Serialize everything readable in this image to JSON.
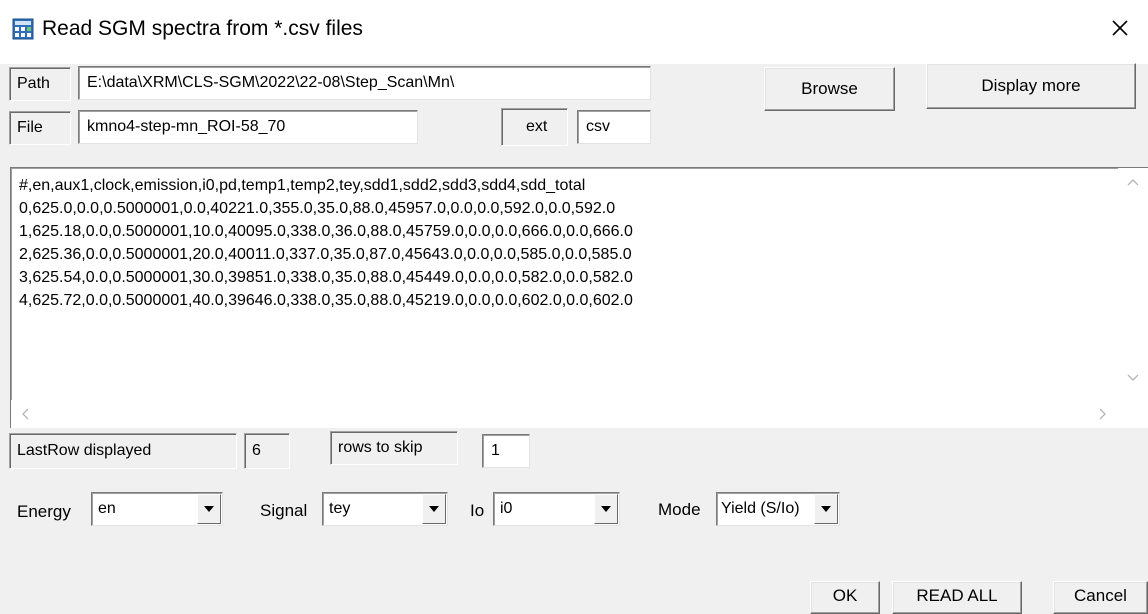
{
  "window": {
    "title": "Read SGM spectra from *.csv files",
    "app_icon": "calculator-table-icon",
    "close_glyph": "✕"
  },
  "path": {
    "label": "Path",
    "value": "E:\\data\\XRM\\CLS-SGM\\2022\\22-08\\Step_Scan\\Mn\\"
  },
  "file": {
    "label": "File",
    "value": "kmno4-step-mn_ROI-58_70"
  },
  "ext": {
    "label": "ext",
    "value": "csv"
  },
  "buttons": {
    "browse": "Browse",
    "display_more": "Display more",
    "ok": "OK",
    "read_all": "READ ALL",
    "cancel": "Cancel"
  },
  "preview": {
    "lines": [
      "#,en,aux1,clock,emission,i0,pd,temp1,temp2,tey,sdd1,sdd2,sdd3,sdd4,sdd_total",
      "0,625.0,0.0,0.5000001,0.0,40221.0,355.0,35.0,88.0,45957.0,0.0,0.0,592.0,0.0,592.0",
      "1,625.18,0.0,0.5000001,10.0,40095.0,338.0,36.0,88.0,45759.0,0.0,0.0,666.0,0.0,666.0",
      "2,625.36,0.0,0.5000001,20.0,40011.0,337.0,35.0,87.0,45643.0,0.0,0.0,585.0,0.0,585.0",
      "3,625.54,0.0,0.5000001,30.0,39851.0,338.0,35.0,88.0,45449.0,0.0,0.0,582.0,0.0,582.0",
      "4,625.72,0.0,0.5000001,40.0,39646.0,338.0,35.0,88.0,45219.0,0.0,0.0,602.0,0.0,602.0"
    ]
  },
  "last_row": {
    "label": "LastRow displayed",
    "value": "6"
  },
  "skip": {
    "label": "rows to skip",
    "value": "1"
  },
  "energy": {
    "label": "Energy",
    "selected": "en"
  },
  "signal": {
    "label": "Signal",
    "selected": "tey"
  },
  "io": {
    "label": "Io",
    "selected": "i0"
  },
  "mode": {
    "label": "Mode",
    "selected": "Yield (S/Io)"
  }
}
